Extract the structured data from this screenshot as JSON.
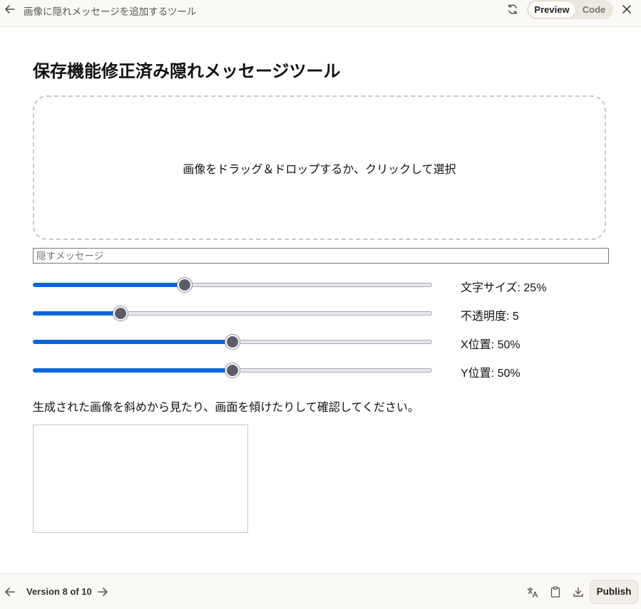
{
  "topbar": {
    "title": "画像に隠れメッセージを追加するツール",
    "preview_label": "Preview",
    "code_label": "Code"
  },
  "main": {
    "page_title": "保存機能修正済み隠れメッセージツール",
    "dropzone_text": "画像をドラッグ＆ドロップするか、クリックして選択",
    "message_input": {
      "placeholder": "隠すメッセージ",
      "value": ""
    },
    "sliders": [
      {
        "label": "文字サイズ: 25%",
        "value_fraction": 0.38
      },
      {
        "label": "不透明度: 5",
        "value_fraction": 0.22
      },
      {
        "label": "X位置: 50%",
        "value_fraction": 0.5
      },
      {
        "label": "Y位置: 50%",
        "value_fraction": 0.5
      }
    ],
    "instruction": "生成された画像を斜めから見たり、画面を傾けたりして確認してください。"
  },
  "bottombar": {
    "version_label": "Version 8 of 10",
    "publish_label": "Publish"
  },
  "colors": {
    "accent": "#0b66d8",
    "thumb": "#5d5d68",
    "background": "#faf9f5"
  },
  "icons": [
    "arrow-left-icon",
    "refresh-icon",
    "close-icon",
    "arrow-right-icon",
    "translate-icon",
    "clipboard-icon",
    "download-icon"
  ]
}
